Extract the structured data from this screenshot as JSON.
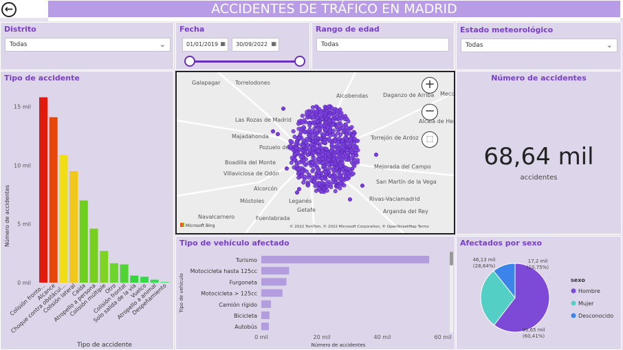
{
  "header": {
    "title": "ACCIDENTES DE TRÁFICO EN MADRID",
    "back_icon": "back-arrow-icon"
  },
  "filters": {
    "distrito": {
      "label": "Distrito",
      "value": "Todas"
    },
    "fecha": {
      "label": "Fecha",
      "start": "01/01/2019",
      "end": "30/09/2022"
    },
    "edad": {
      "label": "Rango de edad",
      "value": "Todas"
    },
    "meteo": {
      "label": "Estado meteorológico",
      "value": "Todas"
    }
  },
  "kpi": {
    "title": "Número de accidentes",
    "value": "68,64 mil",
    "unit": "accidentes"
  },
  "map": {
    "labels": [
      "Galapagar",
      "Torrelodones",
      "Alcobendas",
      "Daganzo de Arriba",
      "Meco",
      "Las Rozas de Madrid",
      "Alcalá de Henares",
      "Majadahonda",
      "Torrejón de Ardoz",
      "Pozuelo de Alarcón",
      "Boadilla del Monte",
      "Mejorada del Campo",
      "Villaviciosa de Odón",
      "San Martín de la Vega",
      "Rivas-Vaciamadrid",
      "Alcorcón",
      "Móstoles",
      "Leganés",
      "Getafe",
      "Arganda del Rey",
      "Navalcarnero",
      "Fuenlabrada"
    ],
    "credit": "© 2022 TomTom, © 2022 Microsoft Corporation, © OpenStreetMap  Terms",
    "bing": "Microsoft Bing"
  },
  "chart_data": [
    {
      "type": "bar",
      "title": "Tipo de accidente",
      "xlabel": "Tipo de accidente",
      "ylabel": "Número de accidentes",
      "ylim": [
        0,
        17000
      ],
      "yticks": [
        "0 mil",
        "5 mil",
        "10 mil",
        "15 mil"
      ],
      "categories": [
        "Colisión fronto...",
        "Alcance",
        "Choque contra obstácul...",
        "Colisión lateral",
        "Caída",
        "Atropello a persona",
        "Colisión múltiple",
        "Otro",
        "Colisión frontal",
        "Solo salida de la vía",
        "Vuelco",
        "Atropello a animal",
        "Despeñamiento"
      ],
      "values": [
        15800,
        14100,
        10900,
        9500,
        7000,
        4600,
        2700,
        1650,
        1550,
        600,
        500,
        250,
        50
      ],
      "colors": [
        "#e01b0e",
        "#e8470c",
        "#efde14",
        "#f0c81a",
        "#6ecf1c",
        "#76d01d",
        "#7fd322",
        "#6cd42a",
        "#4fd434",
        "#38d43e",
        "#34d848",
        "#33dc52",
        "#30dc5e"
      ]
    },
    {
      "type": "bar",
      "title": "Tipo de vehículo afectado",
      "xlabel": "Número de accidentes",
      "ylabel": "Tipo de vehículo",
      "xlim": [
        0,
        60000
      ],
      "xticks": [
        "0 mil",
        "20 mil",
        "40 mil",
        "60 mil"
      ],
      "categories": [
        "Turismo",
        "Motocicleta hasta 125cc",
        "Furgoneta",
        "Motocicleta > 125cc",
        "Camión rígido",
        "Bicicleta",
        "Autobús"
      ],
      "values": [
        55500,
        9200,
        8300,
        7000,
        3200,
        2700,
        2500
      ],
      "color": "#b39ddf"
    },
    {
      "type": "pie",
      "title": "Afectados por sexo",
      "legend_title": "sexo",
      "categories": [
        "Hombre",
        "Mujer",
        "Desconocido"
      ],
      "values": [
        96.65,
        46.13,
        17.2
      ],
      "labels": [
        "96,65 mil",
        "46,13 mil",
        "17,2 mil"
      ],
      "percents": [
        "(60,41%)",
        "(28,84%)",
        "(10,75%)"
      ],
      "colors": [
        "#7c4ad6",
        "#54cfc5",
        "#3b84ea"
      ]
    }
  ]
}
